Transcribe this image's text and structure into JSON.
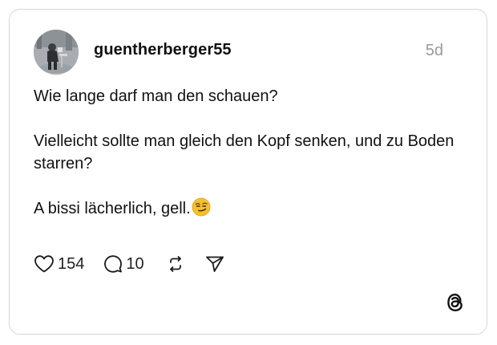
{
  "post": {
    "username": "guentherberger55",
    "timestamp": "5d",
    "paragraphs": [
      "Wie lange darf man den schauen?",
      "Vielleicht sollte man gleich den Kopf senken, und zu Boden starren?",
      "A bissi lächerlich, gell."
    ],
    "emoji": "😏"
  },
  "actions": {
    "likes": "154",
    "replies": "10",
    "like_icon": "heart-icon",
    "reply_icon": "comment-icon",
    "repost_icon": "repost-icon",
    "share_icon": "send-icon"
  },
  "branding": {
    "logo_icon": "threads-logo-icon"
  },
  "colors": {
    "border": "#d6d6d6",
    "text": "#111111",
    "muted": "#9a9a9a",
    "emoji": "#f5c12e"
  }
}
